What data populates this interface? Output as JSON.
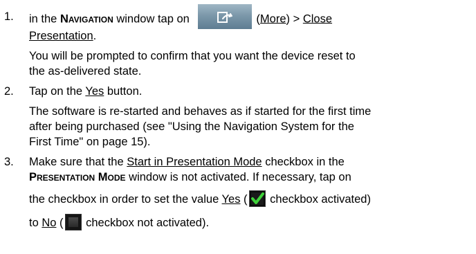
{
  "steps": [
    {
      "number": "1.",
      "line1_prefix": "in the ",
      "line1_window": "Navigation",
      "line1_mid": " window tap on ",
      "line1_paren_open": "(",
      "line1_more": "More",
      "line1_after_more": ") > ",
      "line1_close": "Close",
      "line2_presentation": "Presentation",
      "line2_end": ".",
      "note_line1": "You will be prompted to confirm that you want the device reset to",
      "note_line2": "the as-delivered state."
    },
    {
      "number": "2.",
      "line1_prefix": "Tap on the ",
      "line1_yes": "Yes",
      "line1_suffix": " button.",
      "note_line1": "The software is re-started and behaves as if started for the first time",
      "note_line2": "after being purchased (see \"Using the Navigation System for the",
      "note_line3": "First Time\" on page 15)."
    },
    {
      "number": "3.",
      "line1_prefix": "Make sure that the ",
      "line1_link": "Start in Presentation Mode",
      "line1_suffix": " checkbox in the",
      "line2_window": "Presentation Mode",
      "line2_suffix": " window is not activated. If necessary, tap on",
      "line3_prefix": "the checkbox in order to set the value ",
      "line3_yes": "Yes",
      "line3_paren": " (",
      "line3_after_icon": " checkbox activated)",
      "line4_prefix": "to ",
      "line4_no": "No",
      "line4_paren": " (",
      "line4_after_icon": " checkbox not activated)."
    }
  ],
  "icons": {
    "more_button": "more-arrow-icon",
    "checkbox_checked": "checkbox-checked-icon",
    "checkbox_unchecked": "checkbox-unchecked-icon",
    "accent_green": "#3fd23a",
    "button_blue": "#7c98aa"
  }
}
